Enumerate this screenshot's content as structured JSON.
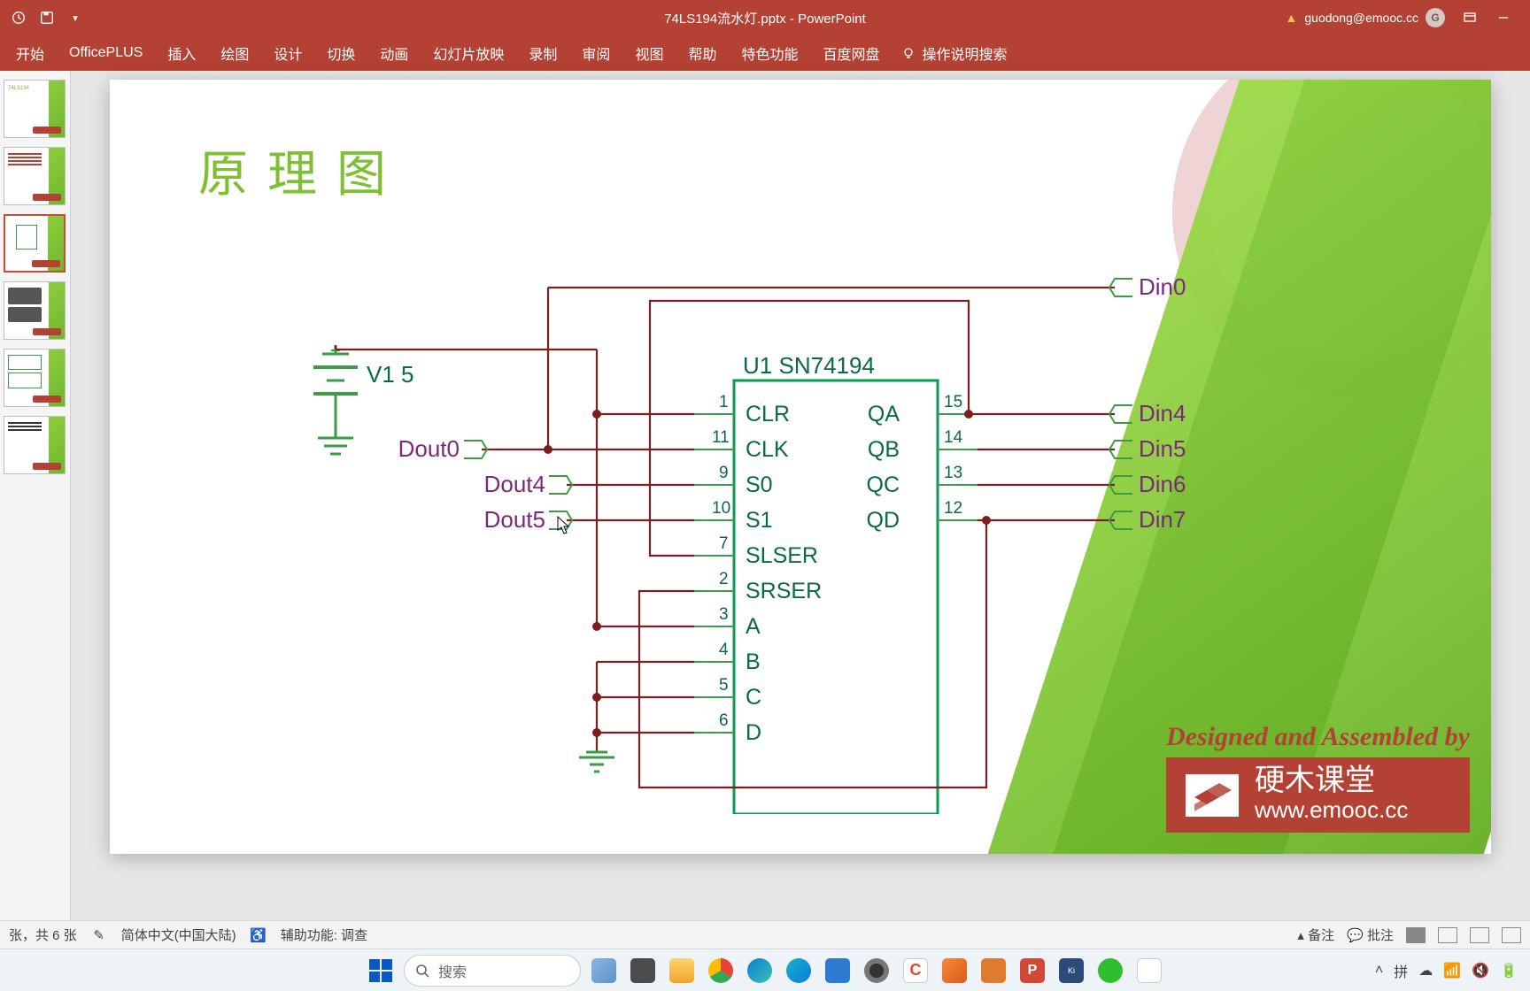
{
  "titlebar": {
    "doc_title": "74LS194流水灯.pptx - PowerPoint",
    "user_email": "guodong@emooc.cc",
    "avatar_initial": "G"
  },
  "ribbon": {
    "tabs": [
      "开始",
      "OfficePLUS",
      "插入",
      "绘图",
      "设计",
      "切换",
      "动画",
      "幻灯片放映",
      "录制",
      "审阅",
      "视图",
      "帮助",
      "特色功能",
      "百度网盘"
    ],
    "tellme": "操作说明搜索"
  },
  "slide": {
    "title": "原理图",
    "chip": {
      "ref": "U1",
      "part": "SN74194",
      "left_pins": [
        {
          "num": "1",
          "name": "CLR"
        },
        {
          "num": "11",
          "name": "CLK"
        },
        {
          "num": "9",
          "name": "S0"
        },
        {
          "num": "10",
          "name": "S1"
        },
        {
          "num": "7",
          "name": "SLSER"
        },
        {
          "num": "2",
          "name": "SRSER"
        },
        {
          "num": "3",
          "name": "A"
        },
        {
          "num": "4",
          "name": "B"
        },
        {
          "num": "5",
          "name": "C"
        },
        {
          "num": "6",
          "name": "D"
        }
      ],
      "right_pins": [
        {
          "num": "15",
          "name": "QA"
        },
        {
          "num": "14",
          "name": "QB"
        },
        {
          "num": "13",
          "name": "QC"
        },
        {
          "num": "12",
          "name": "QD"
        }
      ]
    },
    "nets": {
      "v_ref": "V1",
      "v_val": "5",
      "dout0": "Dout0",
      "dout4": "Dout4",
      "dout5": "Dout5",
      "din0": "Din0",
      "din4": "Din4",
      "din5": "Din5",
      "din6": "Din6",
      "din7": "Din7"
    },
    "brand": {
      "tagline": "Designed and Assembled by",
      "name_cn": "硬木课堂",
      "url": "www.emooc.cc"
    }
  },
  "statusbar": {
    "slide_info": "张，共 6 张",
    "lang": "简体中文(中国大陆)",
    "access": "辅助功能: 调查",
    "notes": "备注",
    "comments": "批注"
  },
  "taskbar": {
    "search_placeholder": "搜索"
  }
}
